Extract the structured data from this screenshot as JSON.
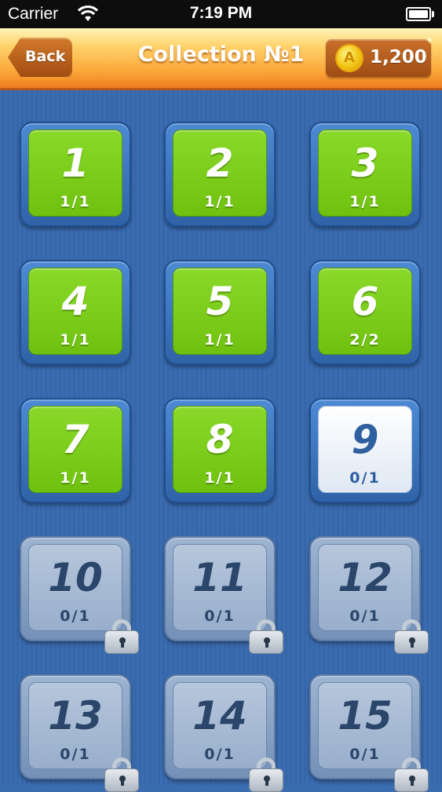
{
  "status_bar": {
    "carrier": "Carrier",
    "time": "7:19 PM"
  },
  "header": {
    "back_label": "Back",
    "title": "Collection №1",
    "coin_symbol": "A",
    "coins": "1,200"
  },
  "levels": [
    {
      "number": "1",
      "progress": "1/1",
      "state": "done"
    },
    {
      "number": "2",
      "progress": "1/1",
      "state": "done"
    },
    {
      "number": "3",
      "progress": "1/1",
      "state": "done"
    },
    {
      "number": "4",
      "progress": "1/1",
      "state": "done"
    },
    {
      "number": "5",
      "progress": "1/1",
      "state": "done"
    },
    {
      "number": "6",
      "progress": "2/2",
      "state": "done"
    },
    {
      "number": "7",
      "progress": "1/1",
      "state": "done"
    },
    {
      "number": "8",
      "progress": "1/1",
      "state": "done"
    },
    {
      "number": "9",
      "progress": "0/1",
      "state": "open"
    },
    {
      "number": "10",
      "progress": "0/1",
      "state": "locked"
    },
    {
      "number": "11",
      "progress": "0/1",
      "state": "locked"
    },
    {
      "number": "12",
      "progress": "0/1",
      "state": "locked"
    },
    {
      "number": "13",
      "progress": "0/1",
      "state": "locked"
    },
    {
      "number": "14",
      "progress": "0/1",
      "state": "locked"
    },
    {
      "number": "15",
      "progress": "0/1",
      "state": "locked"
    }
  ],
  "colors": {
    "background": "#3a6cb0",
    "header": "#fba336",
    "done_tile": "#7cc91b",
    "open_tile": "#ffffff",
    "locked_tile": "#a5b8d2"
  },
  "icons": {
    "back": "back-arrow-icon",
    "coin": "coin-icon",
    "lock": "padlock-icon",
    "wifi": "wifi-icon",
    "battery": "battery-icon"
  }
}
